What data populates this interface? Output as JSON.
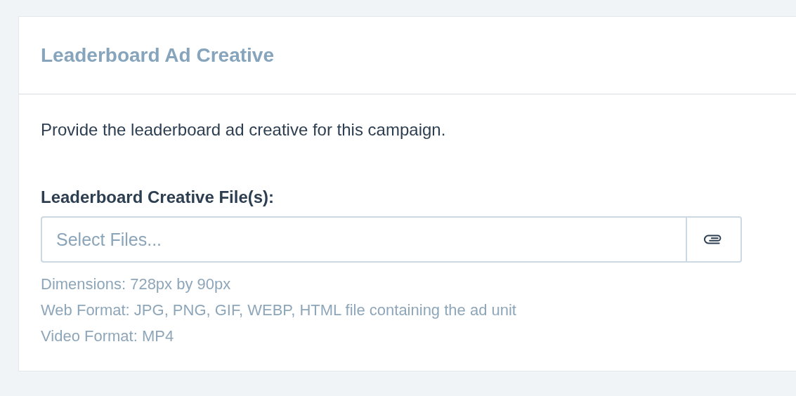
{
  "card": {
    "title": "Leaderboard Ad Creative",
    "description": "Provide the leaderboard ad creative for this campaign.",
    "field": {
      "label": "Leaderboard Creative File(s):",
      "placeholder": "Select Files..."
    },
    "hints": [
      "Dimensions: 728px by 90px",
      "Web Format: JPG, PNG, GIF, WEBP, HTML file containing the ad unit",
      "Video Format: MP4"
    ]
  }
}
